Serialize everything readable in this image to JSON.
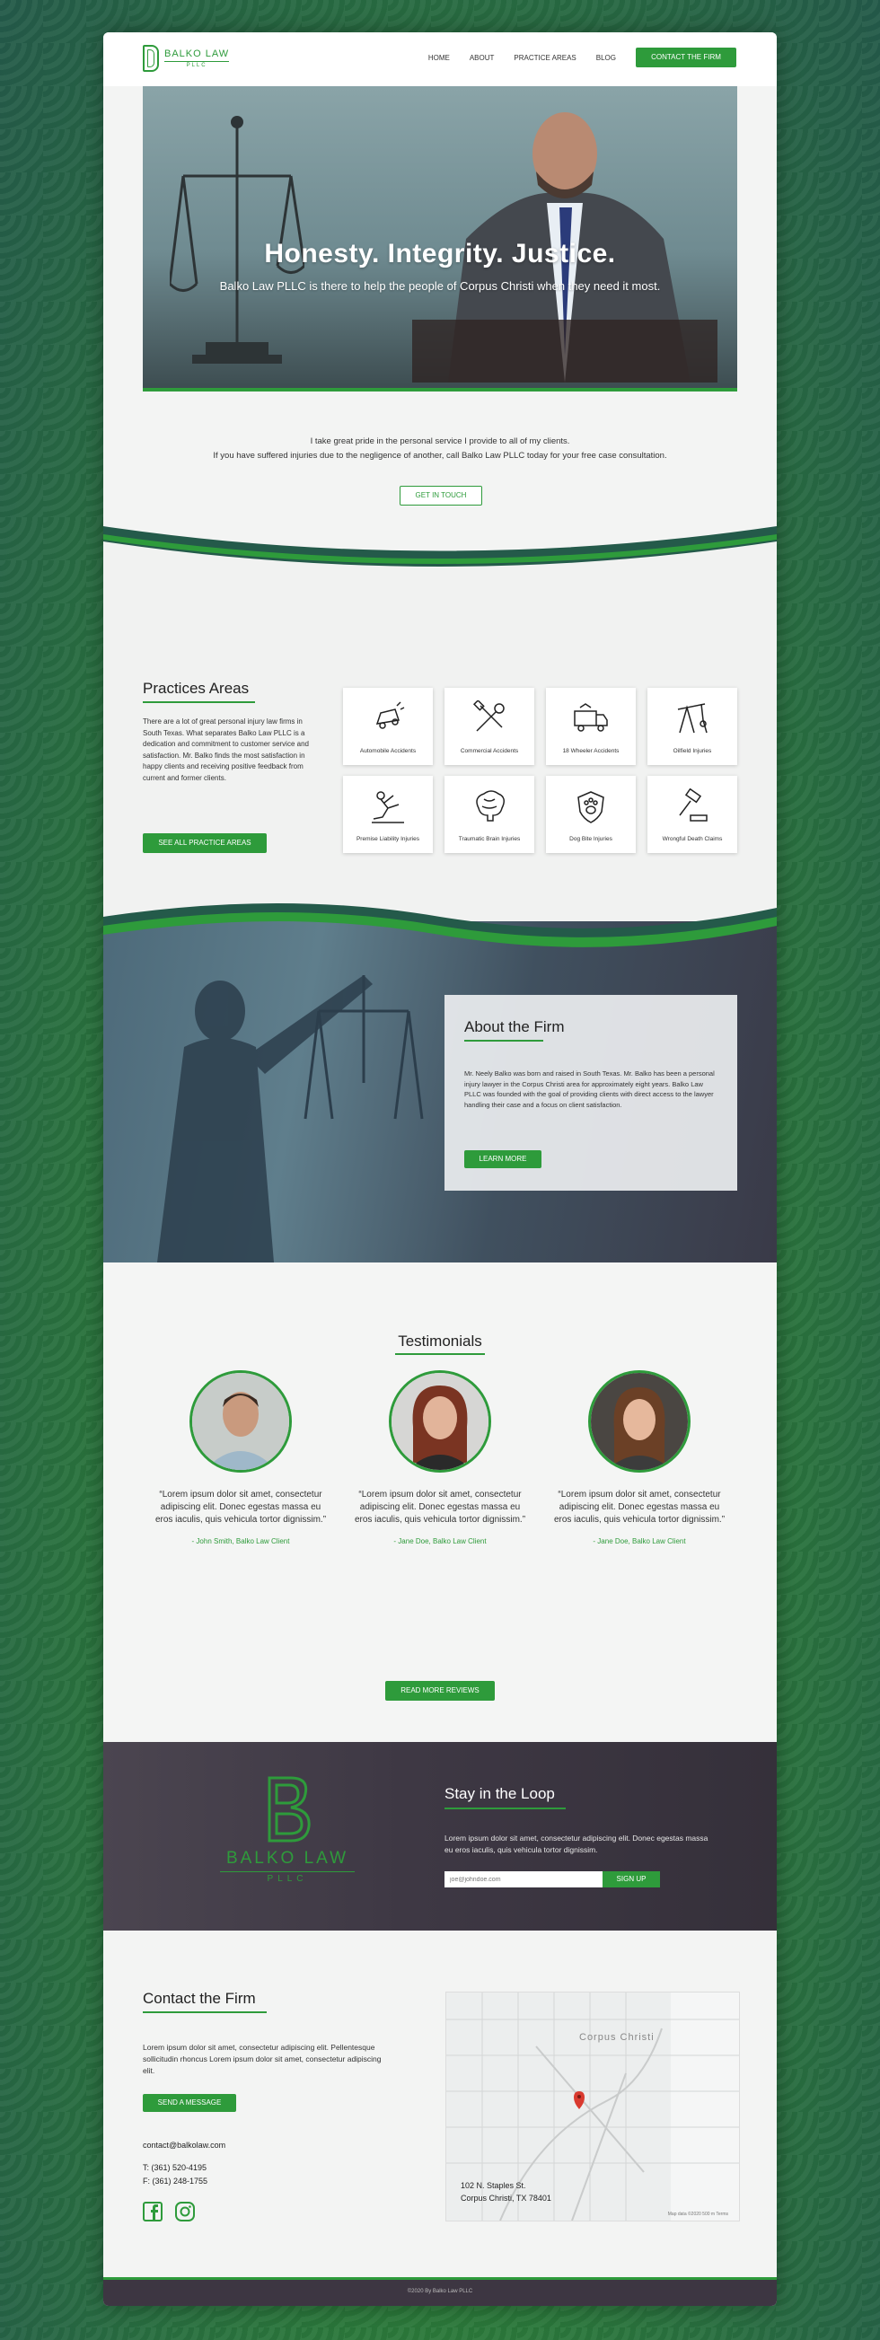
{
  "header": {
    "logo_name": "BALKO LAW",
    "logo_sub": "PLLC",
    "nav": [
      "HOME",
      "ABOUT",
      "PRACTICE AREAS",
      "BLOG"
    ],
    "cta": "CONTACT THE FIRM"
  },
  "hero": {
    "title": "Honesty. Integrity. Justice.",
    "subtitle": "Balko Law PLLC is there to help the people of Corpus Christi when they need it most."
  },
  "intro": {
    "line1": "I take great pride in the personal service I provide to all of my clients.",
    "line2": "If you have suffered injuries due to the negligence of another, call Balko Law PLLC today for your free case consultation.",
    "button": "GET IN TOUCH"
  },
  "practices": {
    "title": "Practices Areas",
    "text": "There are a lot of great personal injury law firms in South Texas.  What separates Balko Law PLLC is a dedication and commitment to customer service and satisfaction. Mr. Balko finds the most satisfaction in happy clients and receiving positive feedback from current and former clients.",
    "button": "SEE ALL PRACTICE AREAS",
    "areas": [
      {
        "label": "Automobile Accidents",
        "icon": "car-crash-icon"
      },
      {
        "label": "Commercial Accidents",
        "icon": "tools-icon"
      },
      {
        "label": "18 Wheeler Accidents",
        "icon": "truck-icon"
      },
      {
        "label": "Oilfield Injuries",
        "icon": "oil-pump-icon"
      },
      {
        "label": "Premise Liability Injuries",
        "icon": "slip-fall-icon"
      },
      {
        "label": "Traumatic Brain Injuries",
        "icon": "brain-icon"
      },
      {
        "label": "Dog Bite Injuries",
        "icon": "paw-shield-icon"
      },
      {
        "label": "Wrongful Death Claims",
        "icon": "gavel-icon"
      }
    ]
  },
  "about": {
    "title": "About the Firm",
    "text": "Mr. Neely Balko was born and raised in South Texas. Mr. Balko has been a personal injury lawyer in the Corpus Christi area for approximately eight years. Balko Law PLLC was founded with the goal of providing clients with direct access to the lawyer handling their case and a focus on client satisfaction.",
    "button": "LEARN MORE"
  },
  "testimonials": {
    "title": "Testimonials",
    "items": [
      {
        "quote": "“Lorem ipsum dolor sit amet, consectetur adipiscing elit. Donec egestas massa eu eros iaculis, quis vehicula tortor dignissim.”",
        "author": "- John Smith, Balko Law Client"
      },
      {
        "quote": "“Lorem ipsum dolor sit amet, consectetur adipiscing elit. Donec egestas massa eu eros iaculis, quis vehicula tortor dignissim.”",
        "author": "- Jane Doe, Balko Law Client"
      },
      {
        "quote": "“Lorem ipsum dolor sit amet, consectetur adipiscing elit. Donec egestas massa eu eros iaculis, quis vehicula tortor dignissim.”",
        "author": "- Jane Doe, Balko Law Client"
      }
    ],
    "button": "READ MORE REVIEWS"
  },
  "newsletter": {
    "logo_name": "BALKO LAW",
    "logo_sub": "PLLC",
    "title": "Stay in the Loop",
    "text": "Lorem ipsum dolor sit amet, consectetur adipiscing elit. Donec egestas massa eu eros iaculis, quis vehicula tortor dignissim.",
    "placeholder": "joe@johndoe.com",
    "button": "SIGN UP"
  },
  "contact": {
    "title": "Contact the Firm",
    "text": "Lorem ipsum dolor sit amet, consectetur adipiscing elit. Pellentesque sollicitudin rhoncus Lorem ipsum dolor sit amet, consectetur adipiscing elit.",
    "button": "SEND A MESSAGE",
    "email": "contact@balkolaw.com",
    "phone": "T: (361) 520-4195",
    "fax": "F: (361) 248-1755",
    "map_city": "Corpus Christi",
    "address_line1": "102 N. Staples St.",
    "address_line2": "Corpus Christi, TX 78401",
    "map_footer": "Map data ©2020   500 m   Terms"
  },
  "footer": {
    "text": "©2020 By Balko Law PLLC"
  },
  "colors": {
    "accent": "#2e9b3b",
    "dark": "#3d3642"
  }
}
